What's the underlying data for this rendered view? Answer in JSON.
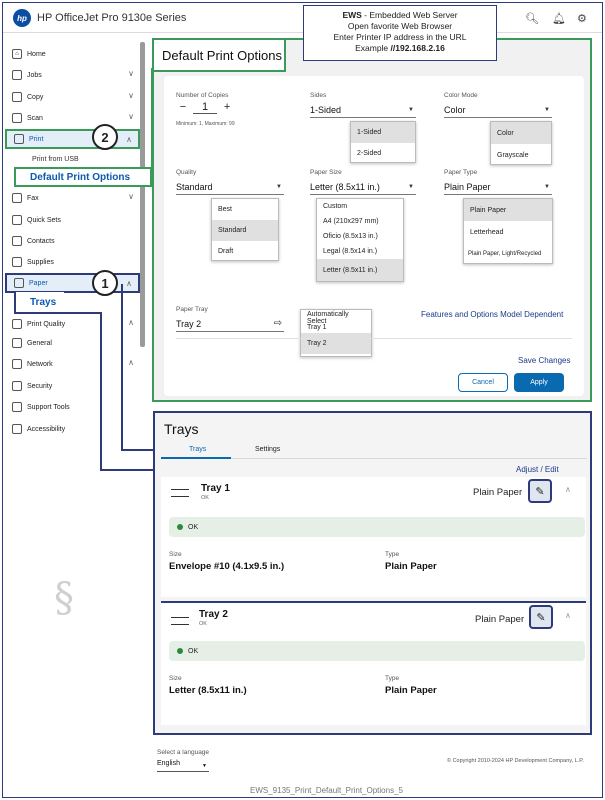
{
  "header": {
    "logo": "hp",
    "title": "HP OfficeJet Pro 9130e Series",
    "icons": [
      "search-icon",
      "bell-icon",
      "user-settings-icon"
    ]
  },
  "ews_note": {
    "title": "EWS",
    "title_rest": " - Embedded Web Server",
    "line2": "Open favorite Web Browser",
    "line3": "Enter Printer IP address in the URL",
    "line4_prefix": "Example ",
    "line4_bold": "//192.168.2.16"
  },
  "sidebar": {
    "items": [
      {
        "label": "Home",
        "icon": "home-icon"
      },
      {
        "label": "Jobs",
        "icon": "jobs-icon"
      },
      {
        "label": "Copy",
        "icon": "copy-icon"
      },
      {
        "label": "Scan",
        "icon": "scan-icon"
      },
      {
        "label": "Print",
        "icon": "print-icon"
      },
      {
        "label": "Fax",
        "icon": "fax-icon"
      },
      {
        "label": "Quick Sets",
        "icon": "quicksets-icon"
      },
      {
        "label": "Contacts",
        "icon": "contacts-icon"
      },
      {
        "label": "Supplies",
        "icon": "supplies-icon"
      },
      {
        "label": "Paper",
        "icon": "paper-icon"
      },
      {
        "label": "Print Quality",
        "icon": "print-quality-icon"
      },
      {
        "label": "General",
        "icon": "general-icon"
      },
      {
        "label": "Network",
        "icon": "network-icon"
      },
      {
        "label": "Security",
        "icon": "security-icon"
      },
      {
        "label": "Support Tools",
        "icon": "tools-icon"
      },
      {
        "label": "Accessibility",
        "icon": "accessibility-icon"
      }
    ],
    "print_sub": "Print from USB",
    "callout_print": "2",
    "callout_paper": "1",
    "tag_print": "Default Print Options",
    "tag_paper": "Trays"
  },
  "print_options": {
    "title": "Default Print Options",
    "copies": {
      "label": "Number of Copies",
      "value": "1",
      "minus": "−",
      "plus": "+",
      "hint": "Minimum: 1, Maximum: 99"
    },
    "sides": {
      "label": "Sides",
      "value": "1-Sided",
      "options": [
        "1-Sided",
        "2-Sided"
      ]
    },
    "color_mode": {
      "label": "Color Mode",
      "value": "Color",
      "options": [
        "Color",
        "Grayscale"
      ]
    },
    "quality": {
      "label": "Quality",
      "value": "Standard",
      "options": [
        "Best",
        "Standard",
        "Draft"
      ]
    },
    "paper_size": {
      "label": "Paper Size",
      "value": "Letter (8.5x11 in.)",
      "options": [
        "Custom",
        "A4 (210x297 mm)",
        "Oficio (8.5x13 in.)",
        "Legal (8.5x14 in.)",
        "Letter (8.5x11 in.)"
      ]
    },
    "paper_type": {
      "label": "Paper Type",
      "value": "Plain Paper",
      "options": [
        "Plain Paper",
        "Letterhead",
        "Plain Paper, Light/Recycled"
      ]
    },
    "paper_tray": {
      "label": "Paper Tray",
      "value": "Tray 2",
      "options": [
        "Automatically Select",
        "Tray 1",
        "Tray 2"
      ]
    },
    "features_note": "Features and Options Model Dependent",
    "save_changes": "Save Changes",
    "cancel": "Cancel",
    "apply": "Apply"
  },
  "trays": {
    "title": "Trays",
    "tabs": [
      "Trays",
      "Settings"
    ],
    "adjust_edit": "Adjust / Edit",
    "items": [
      {
        "name": "Tray 1",
        "sub": "OK",
        "type_right": "Plain Paper",
        "status": "OK",
        "size_label": "Size",
        "size": "Envelope #10 (4.1x9.5 in.)",
        "type_label": "Type",
        "type": "Plain Paper"
      },
      {
        "name": "Tray 2",
        "sub": "OK",
        "type_right": "Plain Paper",
        "status": "OK",
        "size_label": "Size",
        "size": "Letter (8.5x11 in.)",
        "type_label": "Type",
        "type": "Plain Paper"
      }
    ]
  },
  "footer": {
    "language_label": "Select a language",
    "language": "English",
    "copyright": "© Copyright 2010-2024 HP Development Company, L.P.",
    "doc_name": "EWS_9135_Print_Default_Print_Options_",
    "page": "5"
  },
  "colors": {
    "accent": "#0a6ab0",
    "callout_green": "#3a9a5a",
    "callout_navy": "#2f3a7a"
  }
}
